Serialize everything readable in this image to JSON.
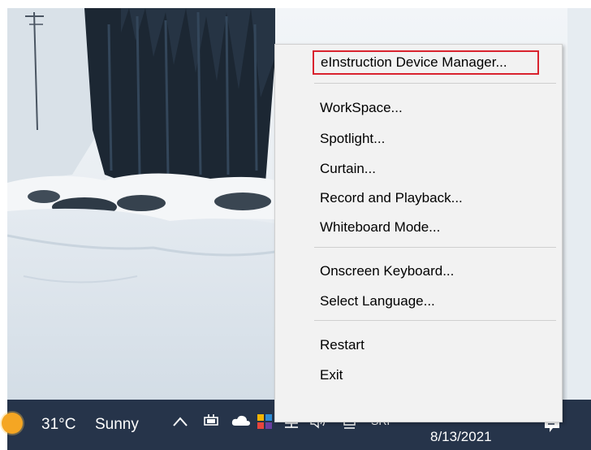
{
  "context_menu": {
    "items": [
      {
        "label": "eInstruction Device Manager..."
      },
      {
        "label": "WorkSpace..."
      },
      {
        "label": "Spotlight..."
      },
      {
        "label": "Curtain..."
      },
      {
        "label": "Record and Playback..."
      },
      {
        "label": "Whiteboard Mode..."
      },
      {
        "label": "Onscreen Keyboard..."
      },
      {
        "label": "Select Language..."
      },
      {
        "label": "Restart"
      },
      {
        "label": "Exit"
      }
    ],
    "highlight_color": "#d9232e"
  },
  "taskbar": {
    "weather": {
      "temperature": "31°C",
      "condition": "Sunny",
      "icon": "sun-icon"
    },
    "tray_icons": [
      "chevron-up-icon",
      "battery-icon",
      "cloud-icon",
      "app-icon",
      "network-icon",
      "volume-icon",
      "pen-icon"
    ],
    "language": "SRP",
    "date": "8/13/2021",
    "notification_icon": "notification-icon",
    "color": "#26344a"
  }
}
